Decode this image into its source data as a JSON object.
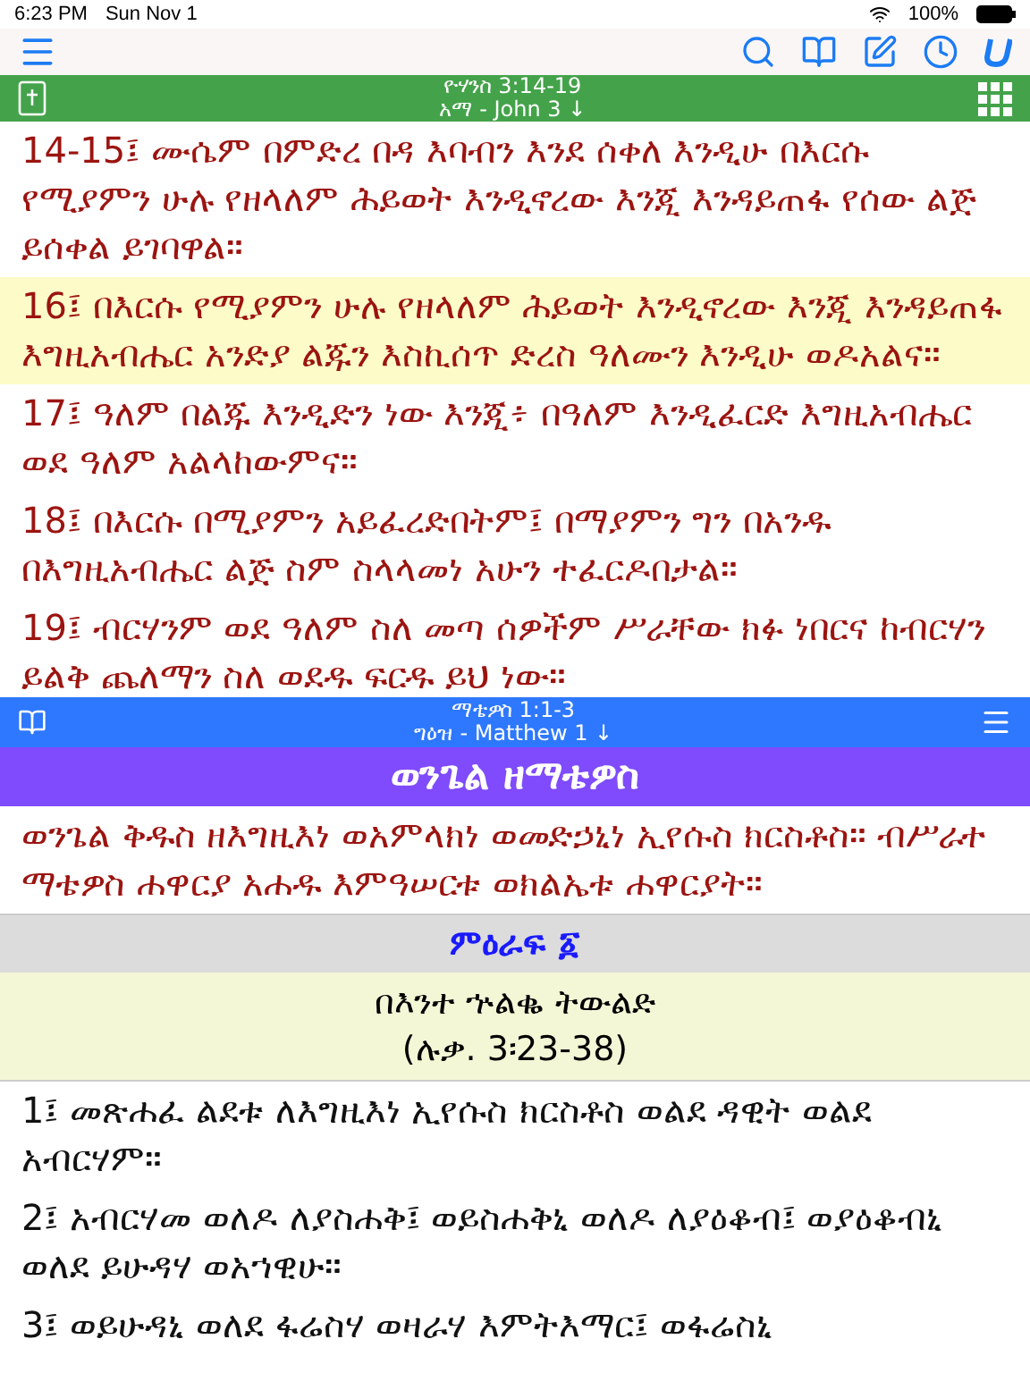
{
  "status_bar": {
    "time": "6:23 PM",
    "date": "Sun Nov 1",
    "battery": "100%"
  },
  "top_pane": {
    "reference": "ዮሃንስ 3:14-19",
    "book_line": "አማ - John 3 ↓",
    "verses": [
      {
        "text": "14-15፤ ሙሴም በምድረ በዳ እባብን እንደ ሰቀለ እንዲሁ በእርሱ የሚያምን ሁሉ የዘላለም ሕይወት እንዲኖረው እንጂ እንዳይጠፋ የሰው ልጅ ይሰቀል ይገባዋል።",
        "selected": false
      },
      {
        "text": "16፤ በእርሱ የሚያምን ሁሉ የዘላለም ሕይወት እንዲኖረው እንጂ እንዳይጠፋ እግዚአብሔር አንድያ ልጁን እስኪሰጥ ድረስ ዓለሙን እንዲሁ ወዶአልና።",
        "selected": true
      },
      {
        "text": "17፤ ዓለም በልጁ እንዲድን ነው እንጂ፥ በዓለም እንዲፈርድ እግዚአብሔር ወደ ዓለም አልላከውምና።",
        "selected": false
      },
      {
        "text": "18፤ በእርሱ በሚያምን አይፈረድበትም፤ በማያምን ግን በአንዱ በእግዚአብሔር ልጅ ስም ስላላመነ አሁን ተፈርዶበታል።",
        "selected": false
      },
      {
        "text": "19፤ ብርሃንም ወደ ዓለም ስለ መጣ ሰዎችም ሥራቸው ክፉ ነበርና ከብርሃን ይልቅ ጨለማን ስለ ወደዱ ፍርዱ ይህ ነው።",
        "selected": false
      }
    ]
  },
  "bottom_pane": {
    "reference": "ማቴዎስ 1:1-3",
    "book_line": "ግዕዝ - Matthew 1 ↓",
    "book_title": "ወንጌል ዘማቴዎስ",
    "intro": "ወንጌል ቅዱስ ዘእግዚእነ ወአምላክነ ወመድኃኒነ ኢየሱስ ክርስቶስ። ብሥራተ ማቴዎስ ሐዋርያ አሐዱ እምዓሠርቱ ወክልኤቱ ሐዋርያት።",
    "chapter": "ምዕራፍ ፩",
    "section_title": "በእንተ ኍልቈ ትውልድ",
    "section_ref": "(ሉቃ. 3፡23-38)",
    "verses": [
      {
        "text": "1፤ መጽሐፈ ልደቱ ለእግዚእነ ኢየሱስ ክርስቶስ ወልደ ዳዊት ወልደ አብርሃም።"
      },
      {
        "text": "2፤ አብርሃመ ወለዶ ለያስሐቅ፤ ወይስሐቅኒ ወለዶ ለያዕቆብ፤ ወያዕቆብኒ ወለደ ይሁዳሃ ወአኀዊሁ።"
      },
      {
        "text": "3፤ ወይሁዳኒ ወለደ ፋሬስሃ ወዛራሃ እምትእማር፤ ወፋሬስኒ"
      }
    ]
  }
}
